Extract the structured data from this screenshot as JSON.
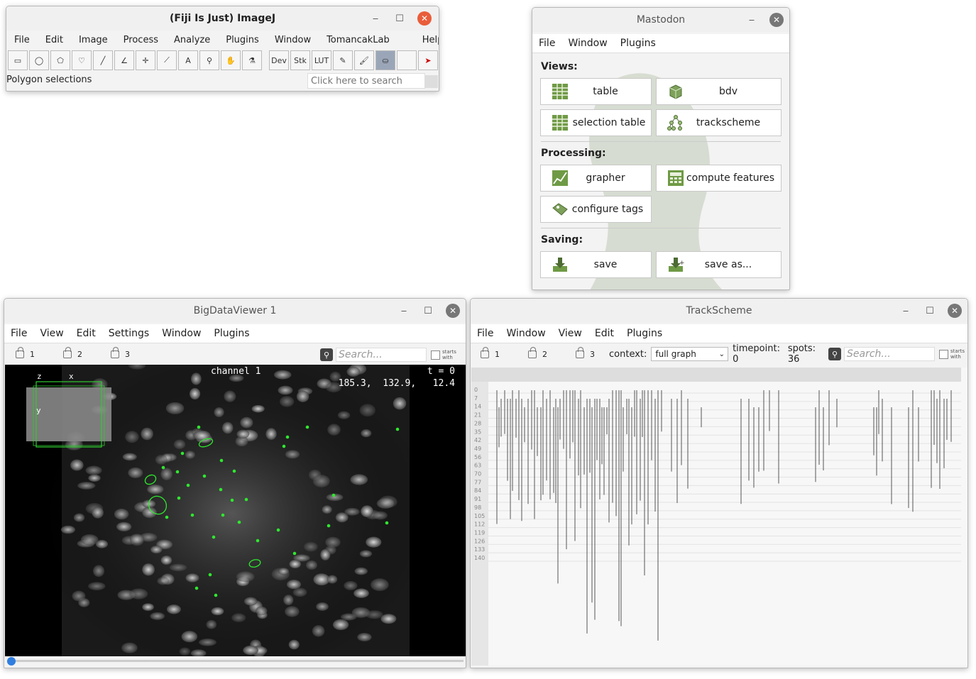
{
  "imagej": {
    "title": "(Fiji Is Just) ImageJ",
    "menu": [
      "File",
      "Edit",
      "Image",
      "Process",
      "Analyze",
      "Plugins",
      "Window",
      "TomancakLab",
      "Help"
    ],
    "tools": [
      {
        "name": "rectangle-tool-icon",
        "glyph": "▭"
      },
      {
        "name": "oval-tool-icon",
        "glyph": "◯"
      },
      {
        "name": "polygon-tool-icon",
        "glyph": "⬠"
      },
      {
        "name": "freehand-tool-icon",
        "glyph": "♡"
      },
      {
        "name": "line-tool-icon",
        "glyph": "╱"
      },
      {
        "name": "angle-tool-icon",
        "glyph": "∠"
      },
      {
        "name": "point-tool-icon",
        "glyph": "✛"
      },
      {
        "name": "wand-tool-icon",
        "glyph": "⟋"
      },
      {
        "name": "text-tool-icon",
        "glyph": "A"
      },
      {
        "name": "magnifier-tool-icon",
        "glyph": "⚲"
      },
      {
        "name": "hand-tool-icon",
        "glyph": "✋"
      },
      {
        "name": "dropper-tool-icon",
        "glyph": "⚗"
      },
      {
        "name": "dev-tool",
        "glyph": "Dev"
      },
      {
        "name": "stk-tool",
        "glyph": "Stk"
      },
      {
        "name": "lut-tool",
        "glyph": "LUT"
      },
      {
        "name": "pencil-tool-icon",
        "glyph": "✎"
      },
      {
        "name": "brush-tool-icon",
        "glyph": "🖌"
      },
      {
        "name": "flood-fill-tool-icon",
        "glyph": "⛀"
      },
      {
        "name": "empty-tool-slot",
        "glyph": ""
      },
      {
        "name": "more-tools-icon",
        "glyph": "➤"
      }
    ],
    "status": "Polygon selections",
    "search_placeholder": "Click here to search"
  },
  "mastodon": {
    "title": "Mastodon",
    "menu": [
      "File",
      "Window",
      "Plugins"
    ],
    "views_label": "Views:",
    "processing_label": "Processing:",
    "saving_label": "Saving:",
    "btn_table": "table",
    "btn_bdv": "bdv",
    "btn_selection_table": "selection table",
    "btn_trackscheme": "trackscheme",
    "btn_grapher": "grapher",
    "btn_compute_features": "compute features",
    "btn_configure_tags": "configure tags",
    "btn_save": "save",
    "btn_save_as": "save as..."
  },
  "bdv": {
    "title": "BigDataViewer 1",
    "menu": [
      "File",
      "View",
      "Edit",
      "Settings",
      "Window",
      "Plugins"
    ],
    "locks": [
      "1",
      "2",
      "3"
    ],
    "search_placeholder": "Search...",
    "starts_with": "starts with",
    "channel": "channel 1",
    "time": "t = 0",
    "coords": "185.3,  132.9,   12.4",
    "axis_z": "z",
    "axis_x": "x",
    "axis_y": "y"
  },
  "trackscheme": {
    "title": "TrackScheme",
    "menu": [
      "File",
      "Window",
      "View",
      "Edit",
      "Plugins"
    ],
    "locks": [
      "1",
      "2",
      "3"
    ],
    "context_label": "context:",
    "context_value": "full graph",
    "timepoint": "timepoint: 0",
    "spots": "spots: 36",
    "search_placeholder": "Search...",
    "starts_with": "starts with",
    "row_labels": [
      "0",
      "7",
      "14",
      "21",
      "28",
      "35",
      "42",
      "49",
      "56",
      "63",
      "70",
      "77",
      "84",
      "91",
      "98",
      "105",
      "112",
      "119",
      "126",
      "133",
      "140"
    ]
  }
}
